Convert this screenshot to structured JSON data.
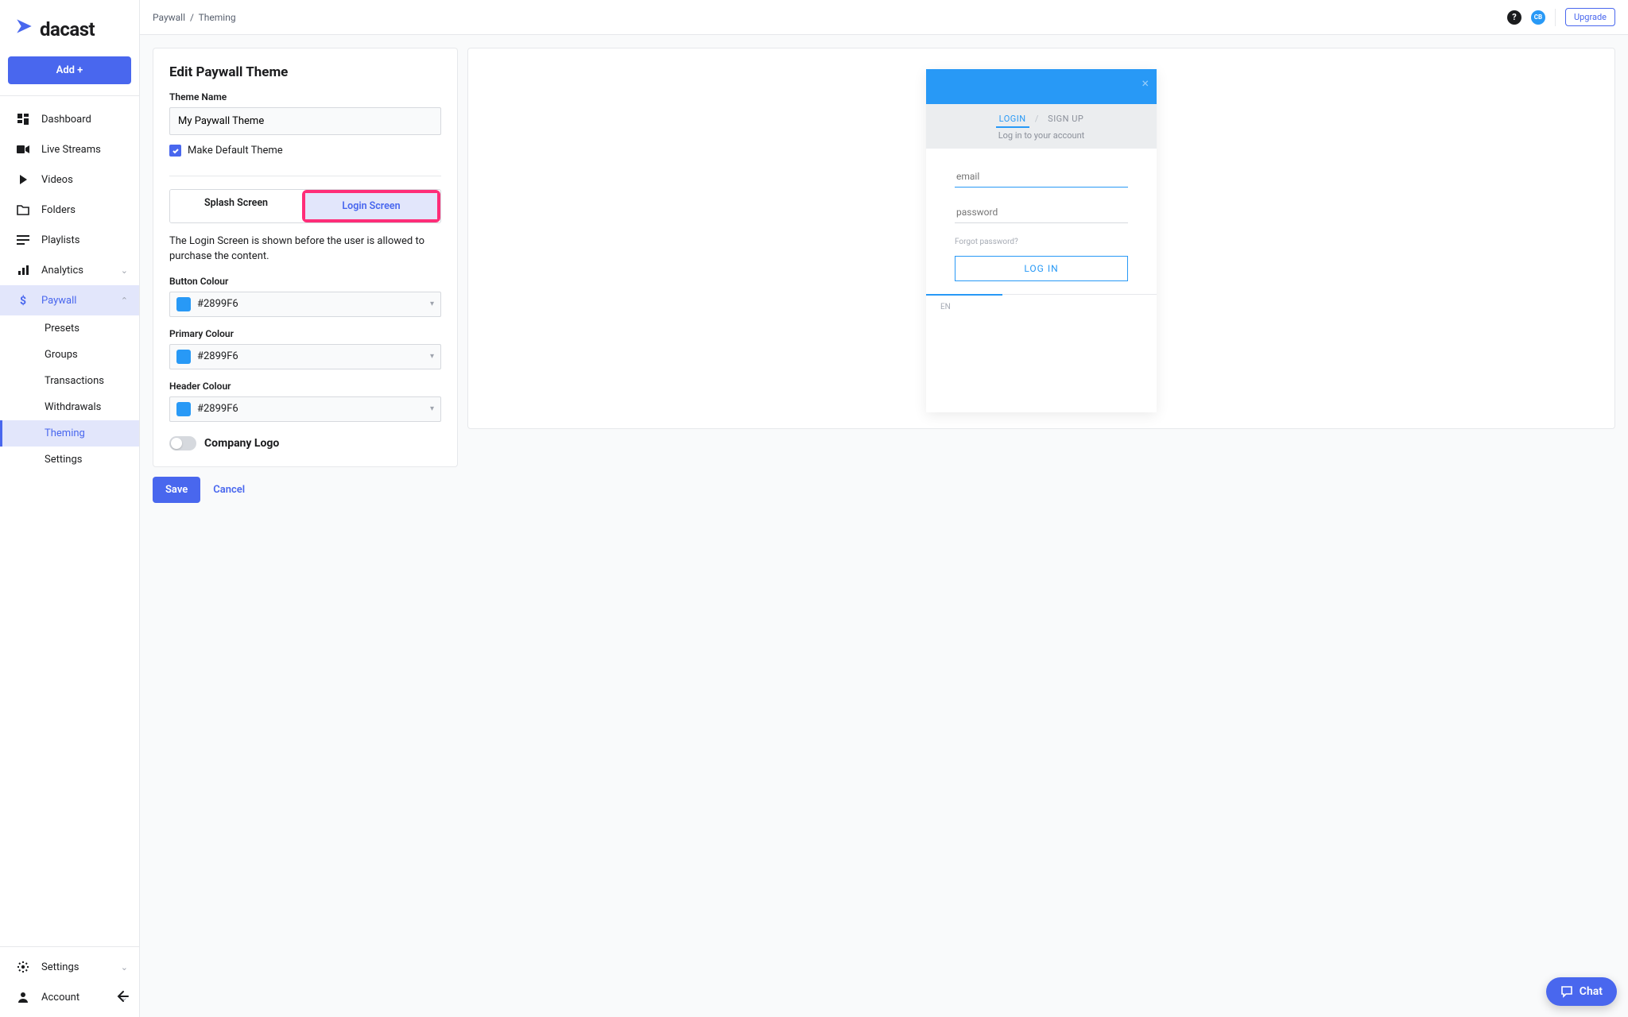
{
  "brand": {
    "name": "dacast"
  },
  "sidebar": {
    "add_label": "Add +",
    "items": [
      {
        "label": "Dashboard"
      },
      {
        "label": "Live Streams"
      },
      {
        "label": "Videos"
      },
      {
        "label": "Folders"
      },
      {
        "label": "Playlists"
      },
      {
        "label": "Analytics"
      },
      {
        "label": "Paywall"
      }
    ],
    "paywall_children": [
      {
        "label": "Presets"
      },
      {
        "label": "Groups"
      },
      {
        "label": "Transactions"
      },
      {
        "label": "Withdrawals"
      },
      {
        "label": "Theming"
      },
      {
        "label": "Settings"
      }
    ],
    "bottom": [
      {
        "label": "Settings"
      },
      {
        "label": "Account"
      }
    ]
  },
  "topbar": {
    "crumb1": "Paywall",
    "crumb2": "Theming",
    "avatar_initials": "CB",
    "upgrade_label": "Upgrade"
  },
  "form": {
    "title": "Edit Paywall Theme",
    "theme_name_label": "Theme Name",
    "theme_name_value": "My Paywall Theme",
    "make_default_label": "Make Default Theme",
    "tabs": {
      "splash": "Splash Screen",
      "login": "Login Screen"
    },
    "login_desc": "The Login Screen is shown before the user is allowed to purchase the content.",
    "button_colour_label": "Button Colour",
    "primary_colour_label": "Primary Colour",
    "header_colour_label": "Header Colour",
    "colour_value": "#2899F6",
    "company_logo_label": "Company Logo",
    "save_label": "Save",
    "cancel_label": "Cancel"
  },
  "preview": {
    "tab_login": "LOGIN",
    "tab_signup": "SIGN UP",
    "subtitle": "Log in to your account",
    "email_ph": "email",
    "password_ph": "password",
    "forgot": "Forgot password?",
    "login_btn": "LOG IN",
    "lang": "EN"
  },
  "chat": {
    "label": "Chat"
  }
}
